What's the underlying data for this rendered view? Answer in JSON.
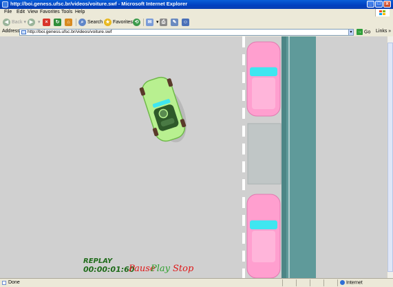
{
  "window": {
    "title": "http://boi.geness.ufsc.br/videos/voiture.swf - Microsoft Internet Explorer",
    "minimize": "_",
    "maximize": "□",
    "close": "x"
  },
  "menu": {
    "items": [
      "File",
      "Edit",
      "View",
      "Favorites",
      "Tools",
      "Help"
    ]
  },
  "toolbar": {
    "back": "Back",
    "search": "Search",
    "favorites": "Favorites"
  },
  "address": {
    "label": "Address",
    "url": "http://boi.geness.ufsc.br/videos/voiture.swf",
    "go": "Go",
    "links": "Links"
  },
  "flash": {
    "replay_label": "REPLAY",
    "timer": "00:00:01:60",
    "pause_label": "Pause",
    "play_label": "Play",
    "stop_label": "Stop",
    "colors": {
      "background": "#d0d0d0",
      "player_car": "#b8f090",
      "parked_car": "#ff9fcf",
      "windshield": "#3fe6f0",
      "sidewalk": "#5f9a9a",
      "replay_text": "#1f6b1a",
      "pause": "#e01818",
      "play": "#2ea02e",
      "stop": "#e01818"
    }
  },
  "status": {
    "text": "Done",
    "zone": "Internet"
  }
}
